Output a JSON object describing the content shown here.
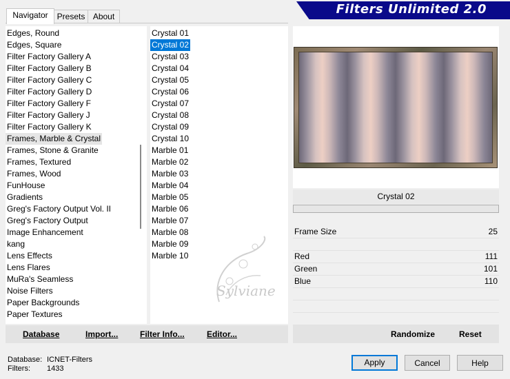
{
  "tabs": [
    {
      "label": "Navigator",
      "active": true
    },
    {
      "label": "Presets",
      "active": false
    },
    {
      "label": "About",
      "active": false
    }
  ],
  "banner": {
    "title": "Filters Unlimited 2.0",
    "color": "#0a0a8a"
  },
  "categories": {
    "items": [
      "Edges, Round",
      "Edges, Square",
      "Filter Factory Gallery A",
      "Filter Factory Gallery B",
      "Filter Factory Gallery C",
      "Filter Factory Gallery D",
      "Filter Factory Gallery F",
      "Filter Factory Gallery J",
      "Filter Factory Gallery K",
      "Frames, Marble & Crystal",
      "Frames, Stone & Granite",
      "Frames, Textured",
      "Frames, Wood",
      "FunHouse",
      "Gradients",
      "Greg's Factory Output Vol. II",
      "Greg's Factory Output",
      "Image Enhancement",
      "kang",
      "Lens Effects",
      "Lens Flares",
      "MuRa's Seamless",
      "Noise Filters",
      "Paper Backgrounds",
      "Paper Textures"
    ],
    "highlighted": "Frames, Marble & Crystal"
  },
  "filters": {
    "items": [
      "Crystal 01",
      "Crystal 02",
      "Crystal 03",
      "Crystal 04",
      "Crystal 05",
      "Crystal 06",
      "Crystal 07",
      "Crystal 08",
      "Crystal 09",
      "Crystal 10",
      "Marble 01",
      "Marble 02",
      "Marble 03",
      "Marble 04",
      "Marble 05",
      "Marble 06",
      "Marble 07",
      "Marble 08",
      "Marble 09",
      "Marble 10"
    ],
    "selected": "Crystal 02"
  },
  "preview": {
    "filter_name": "Crystal 02"
  },
  "params": [
    {
      "label": "Frame Size",
      "value": "25"
    },
    {
      "label": "Red",
      "value": "111"
    },
    {
      "label": "Green",
      "value": "101"
    },
    {
      "label": "Blue",
      "value": "110"
    }
  ],
  "toolbar": {
    "database": "Database",
    "import": "Import...",
    "filter_info": "Filter Info...",
    "editor": "Editor...",
    "randomize": "Randomize",
    "reset": "Reset"
  },
  "buttons": {
    "apply": "Apply",
    "cancel": "Cancel",
    "help": "Help"
  },
  "status": {
    "database_label": "Database:",
    "database_value": "ICNET-Filters",
    "filters_label": "Filters:",
    "filters_value": "1433"
  },
  "watermark": "Sylviane",
  "accent_color": "#0078d7"
}
